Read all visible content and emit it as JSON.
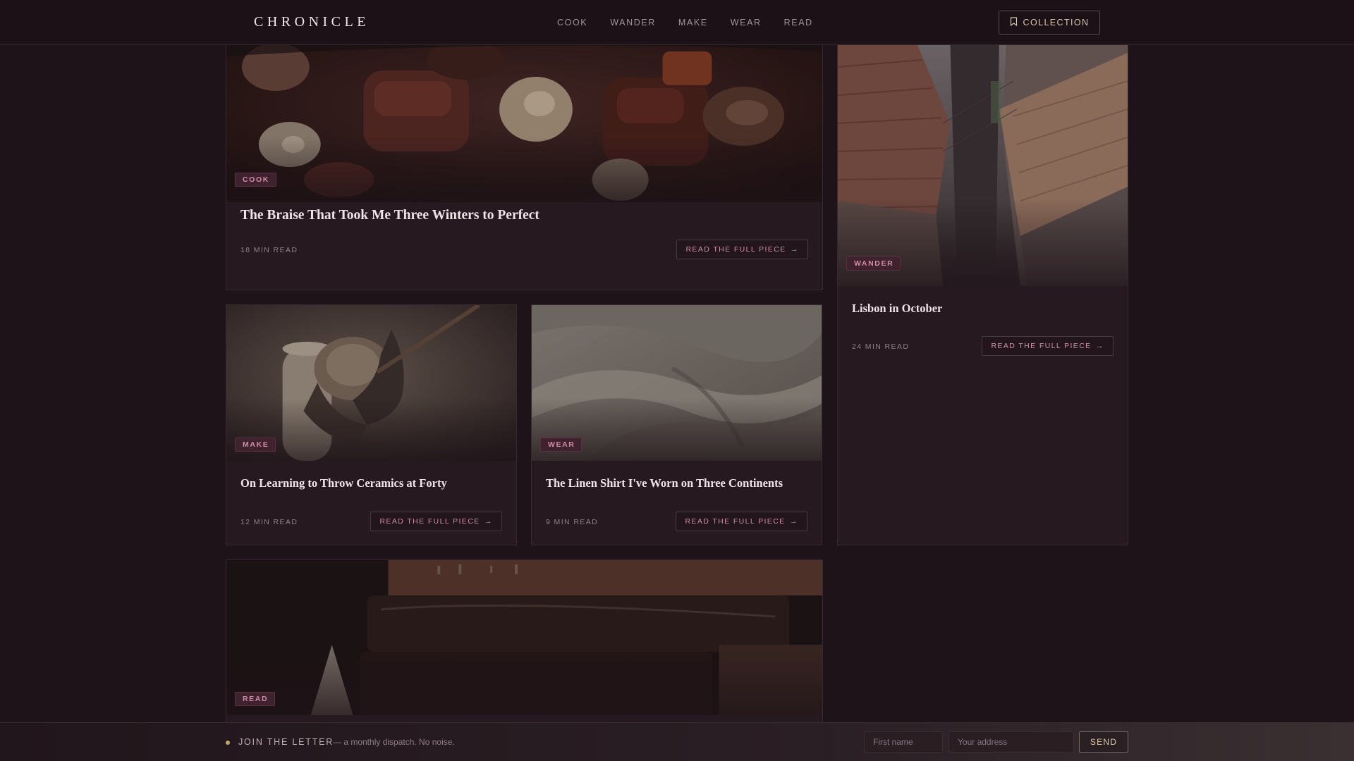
{
  "header": {
    "brand": "CHRONICLE",
    "nav": [
      "COOK",
      "WANDER",
      "MAKE",
      "WEAR",
      "READ"
    ],
    "collection_label": "COLLECTION",
    "collection_icon": "bookmark-icon"
  },
  "cards": {
    "braise": {
      "tag": "COOK",
      "title": "The Braise That Took Me Three Winters to Perfect",
      "read_time": "18 MIN READ",
      "cta": "READ THE FULL PIECE"
    },
    "lisbon": {
      "tag": "WANDER",
      "title": "Lisbon in October",
      "read_time": "24 MIN READ",
      "cta": "READ THE FULL PIECE"
    },
    "ceramics": {
      "tag": "MAKE",
      "title": "On Learning to Throw Ceramics at Forty",
      "read_time": "12 MIN READ",
      "cta": "READ THE FULL PIECE"
    },
    "linen": {
      "tag": "WEAR",
      "title": "The Linen Shirt I've Worn on Three Continents",
      "read_time": "9 MIN READ",
      "cta": "READ THE FULL PIECE"
    },
    "books": {
      "tag": "READ"
    }
  },
  "newsletter": {
    "title": "JOIN THE LETTER",
    "subtitle": "— a monthly dispatch. No noise.",
    "first_name_placeholder": "First name",
    "address_placeholder": "Your address",
    "send_label": "SEND"
  },
  "colors": {
    "background": "#1e1318",
    "card": "#261a20",
    "tag_text": "#d28aa6",
    "accent_gold": "#c9a56a"
  }
}
